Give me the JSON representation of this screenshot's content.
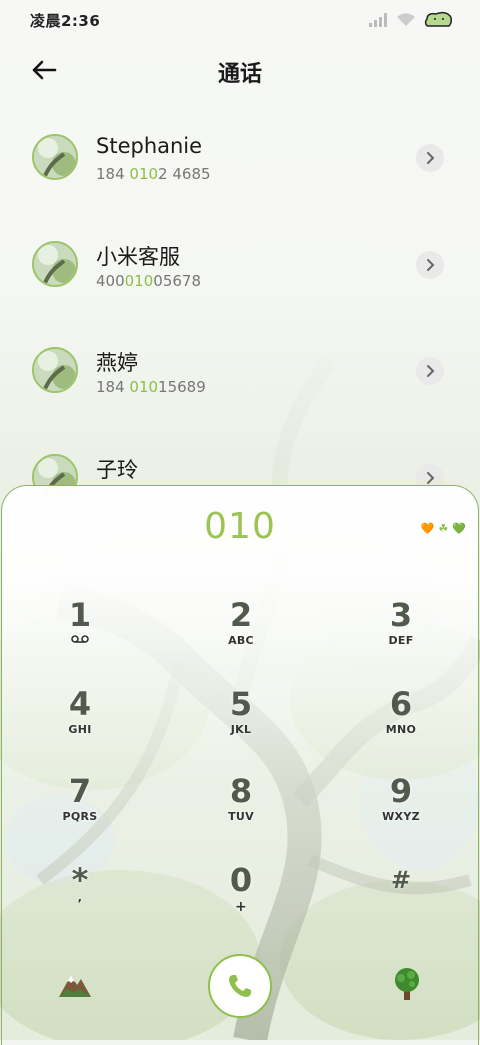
{
  "status_bar": {
    "time": "凌晨2:36",
    "icons": [
      "signal-icon",
      "wifi-icon",
      "battery-icon"
    ]
  },
  "header": {
    "title": "通话",
    "back_icon": "back-arrow-icon"
  },
  "contacts": [
    {
      "name": "Stephanie",
      "number_pre": "184 ",
      "number_match": "010",
      "number_post": "2 4685"
    },
    {
      "name": "小米客服",
      "number_pre": "400",
      "number_match": "010",
      "number_post": "05678"
    },
    {
      "name": "燕婷",
      "number_pre": "184 ",
      "number_match": "010",
      "number_post": "15689"
    },
    {
      "name": "子玲",
      "number_pre": "",
      "number_match": "",
      "number_post": ""
    }
  ],
  "dialer": {
    "dialed_number": "010",
    "emojis": [
      "🧡",
      "☘",
      "💚"
    ],
    "keys": [
      {
        "digit": "1",
        "letters": ""
      },
      {
        "digit": "2",
        "letters": "ABC"
      },
      {
        "digit": "3",
        "letters": "DEF"
      },
      {
        "digit": "4",
        "letters": "GHI"
      },
      {
        "digit": "5",
        "letters": "JKL"
      },
      {
        "digit": "6",
        "letters": "MNO"
      },
      {
        "digit": "7",
        "letters": "PQRS"
      },
      {
        "digit": "8",
        "letters": "TUV"
      },
      {
        "digit": "9",
        "letters": "WXYZ"
      },
      {
        "digit": "*",
        "letters": ","
      },
      {
        "digit": "0",
        "letters": "+"
      },
      {
        "digit": "#",
        "letters": ""
      }
    ],
    "left_icon": "mountain-icon",
    "call_icon": "phone-icon",
    "right_icon": "tree-icon"
  },
  "colors": {
    "accent": "#8cbf48",
    "call_border": "#8fbf4d",
    "panel_border": "#8fb067"
  }
}
